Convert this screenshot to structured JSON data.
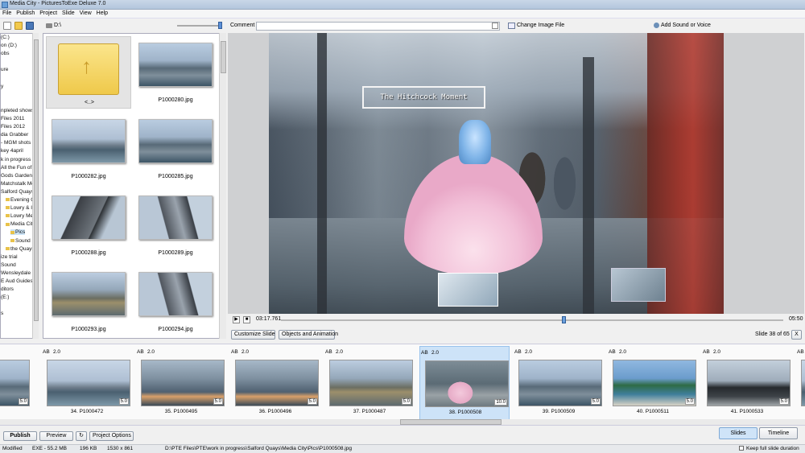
{
  "window": {
    "title": "Media City - PicturesToExe Deluxe 7.0"
  },
  "menu": [
    "File",
    "Publish",
    "Project",
    "Slide",
    "View",
    "Help"
  ],
  "toolbar": {
    "path": "D:\\",
    "comment_label": "Comment",
    "comment_value": "",
    "change_image": "Change Image File",
    "add_sound": "Add Sound or Voice"
  },
  "tree": [
    "(C:)",
    "on (D:)",
    "obs",
    "",
    "ure",
    "",
    "y",
    "",
    "",
    "npleted shows",
    "Files 2011",
    "Files 2012",
    "dia Grabber",
    "- MGM shots",
    "key 4april",
    "k in progress",
    "All the Fun of th",
    "Gods Garden",
    "Matchstalk Mer",
    "Salford Quays",
    "Evening Qu",
    "Lowry & IW",
    "Lowry Meal",
    "Media City",
    "Pics",
    "Sound",
    "the Quays",
    "ize trial",
    "Sound",
    "Wensleydale Sh",
    "E Aud Guides &",
    "ditors",
    "(E:)",
    "",
    "s"
  ],
  "browser": {
    "up_label": "<..>",
    "files": [
      "P1000280.jpg",
      "P1000282.jpg",
      "P1000285.jpg",
      "P1000288.jpg",
      "P1000289.jpg",
      "P1000293.jpg",
      "P1000294.jpg"
    ]
  },
  "preview": {
    "caption": "The Hitchcock Moment",
    "time_current": "03:17.761",
    "time_total": "05:50",
    "position_fraction": 0.564
  },
  "controls": {
    "customize": "Customize Slide",
    "objects": "Objects and Animation",
    "slide_counter": "Slide 38 of 65",
    "close": "X"
  },
  "slides": [
    {
      "ab": "",
      "dur": "",
      "len": "5.0",
      "cap": "471",
      "ph": "ph-city2"
    },
    {
      "ab": "AB",
      "dur": "2.0",
      "len": "5.0",
      "cap": "34. P1000472",
      "ph": "ph-city"
    },
    {
      "ab": "AB",
      "dur": "2.0",
      "len": "5.0",
      "cap": "35. P1000495",
      "ph": "ph-glass"
    },
    {
      "ab": "AB",
      "dur": "2.0",
      "len": "5.0",
      "cap": "36. P1000496",
      "ph": "ph-glass"
    },
    {
      "ab": "AB",
      "dur": "2.0",
      "len": "5.0",
      "cap": "37. P1000487",
      "ph": "ph-street"
    },
    {
      "ab": "AB",
      "dur": "2.0",
      "len": "10.0",
      "cap": "38. P1000508",
      "ph": "ph-dress"
    },
    {
      "ab": "AB",
      "dur": "2.0",
      "len": "5.0",
      "cap": "39. P1000509",
      "ph": "ph-city2"
    },
    {
      "ab": "AB",
      "dur": "2.0",
      "len": "5.0",
      "cap": "40. P1000511",
      "ph": "ph-bluebld"
    },
    {
      "ab": "AB",
      "dur": "2.0",
      "len": "5.0",
      "cap": "41. P1000533",
      "ph": "ph-dark"
    },
    {
      "ab": "AB",
      "dur": "",
      "len": "",
      "cap": "",
      "ph": "ph-city"
    }
  ],
  "bottom": {
    "publish": "Publish",
    "preview": "Preview",
    "options": "Project Options",
    "tab_slides": "Slides",
    "tab_timeline": "Timeline"
  },
  "status": {
    "modified": "Modified",
    "exe": "EXE - 55.2 MB",
    "filesize": "196 KB",
    "dimensions": "1530 x 861",
    "path": "D:\\PTE Files\\PTE\\work in progress\\Salford Quays\\Media City\\Pics\\P1000508.jpg",
    "keep_duration": "Keep full slide duration"
  }
}
